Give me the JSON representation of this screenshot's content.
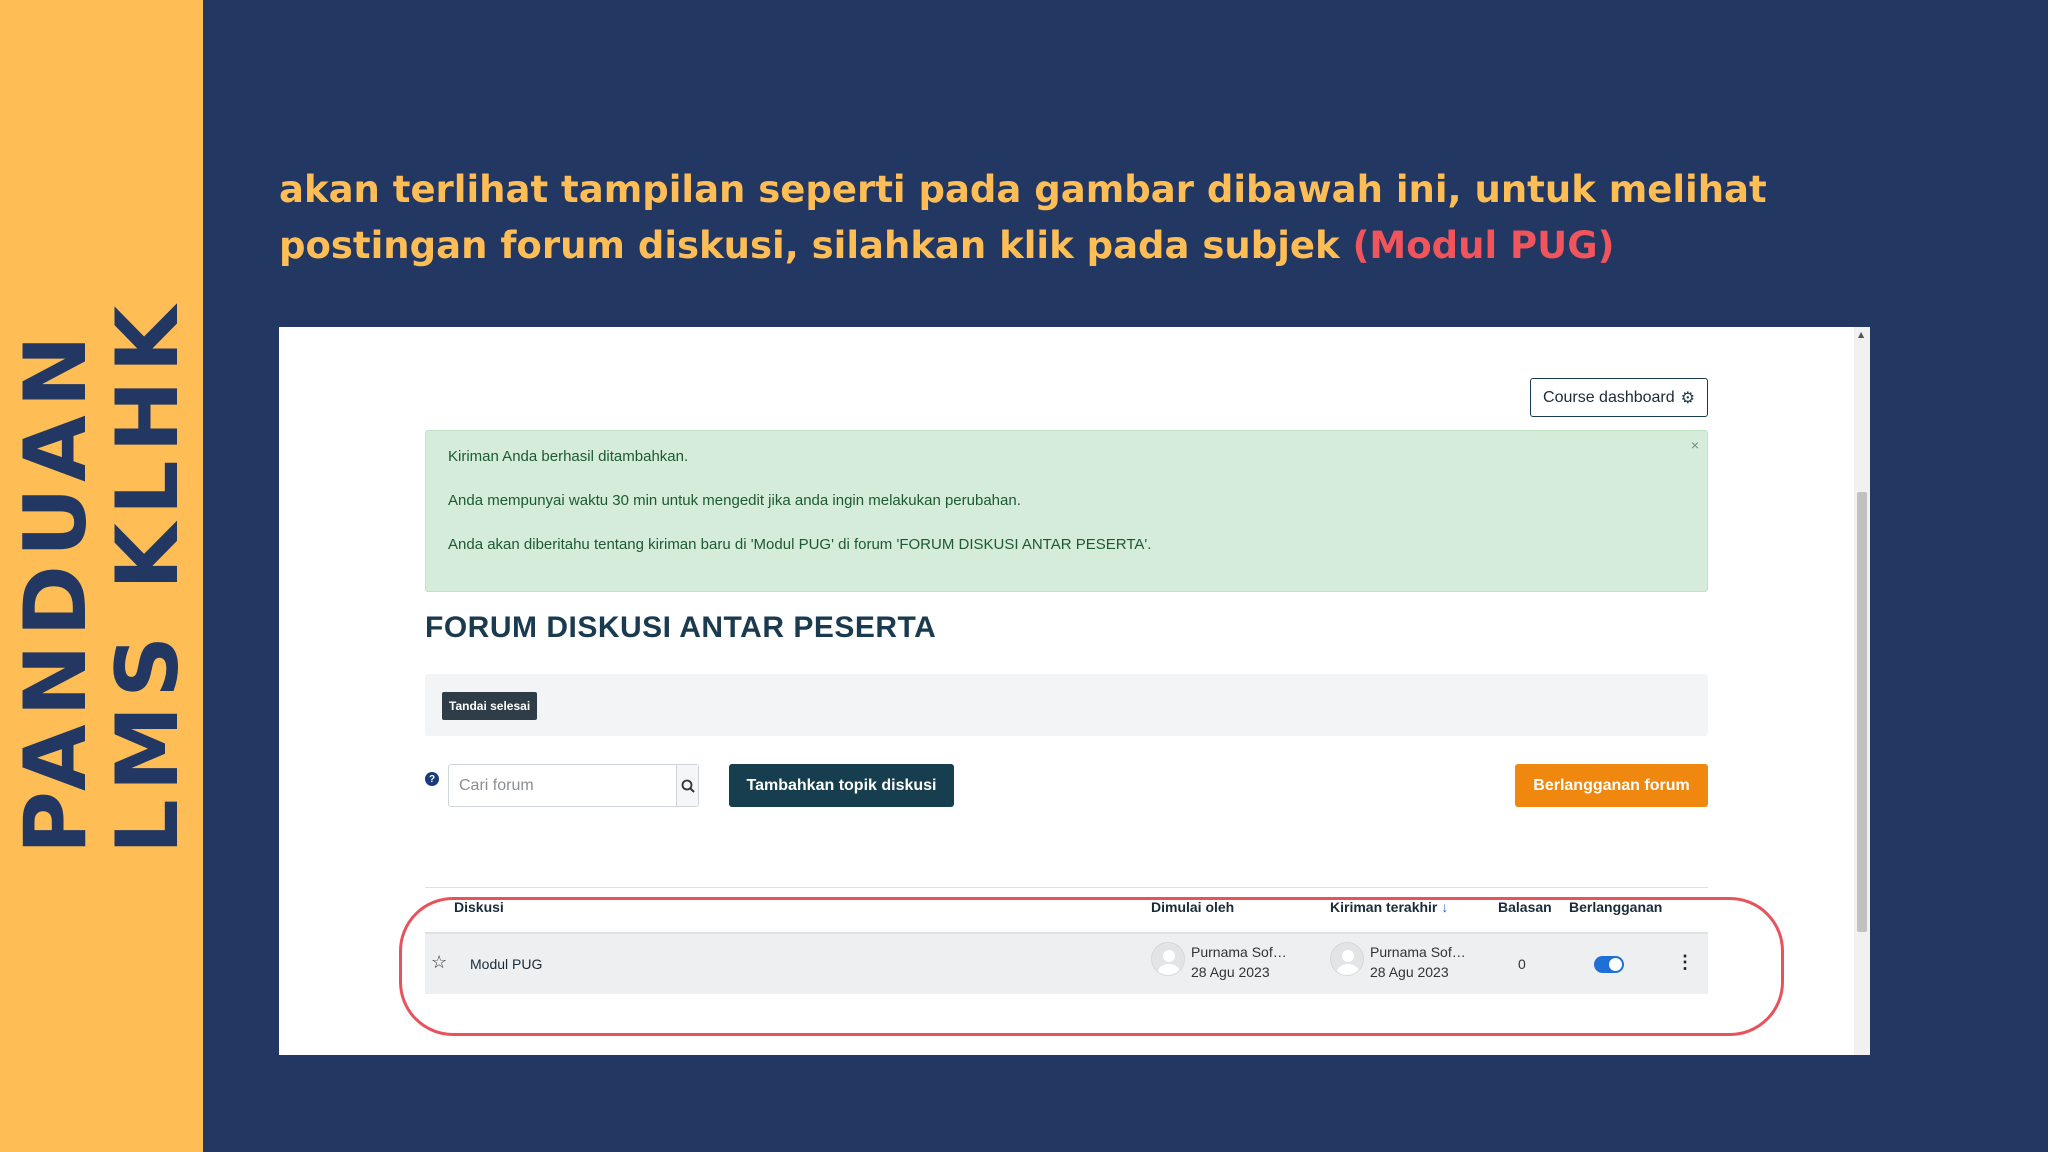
{
  "side_title": {
    "line1": "PANDUAN",
    "line2": "LMS KLHK"
  },
  "instruction": {
    "text": "akan terlihat tampilan seperti pada gambar dibawah ini, untuk melihat postingan forum diskusi, silahkan klik  pada subjek ",
    "highlight": "(Modul PUG)"
  },
  "colors": {
    "background": "#223761",
    "side_band": "#FEBE55",
    "instruction_text": "#FEBE55",
    "highlight": "#F2545B",
    "ring": "#E8525C"
  },
  "lms": {
    "course_dashboard_label": "Course dashboard",
    "alert": {
      "line1": "Kiriman Anda berhasil ditambahkan.",
      "line2": "Anda mempunyai waktu 30 min untuk mengedit jika anda ingin melakukan perubahan.",
      "line3": "Anda akan diberitahu tentang kiriman baru di 'Modul PUG' di forum 'FORUM DISKUSI ANTAR PESERTA'.",
      "close": "×"
    },
    "forum_title": "FORUM DISKUSI ANTAR PESERTA",
    "completion_badge": "Tandai selesai",
    "help_symbol": "?",
    "search_placeholder": "Cari forum",
    "add_topic_label": "Tambahkan topik diskusi",
    "subscribe_label": "Berlangganan forum",
    "table": {
      "headers": {
        "discussion": "Diskusi",
        "started_by": "Dimulai oleh",
        "last_post": "Kiriman terakhir",
        "sort_arrow": "↓",
        "replies": "Balasan",
        "subscription": "Berlangganan"
      },
      "rows": [
        {
          "subject": "Modul PUG",
          "started_by_name": "Purnama Sof…",
          "started_by_date": "28 Agu 2023",
          "last_post_name": "Purnama Sof…",
          "last_post_date": "28 Agu 2023",
          "replies": "0",
          "subscribed": true
        }
      ]
    },
    "icons": {
      "gear": "⚙",
      "search": "search-icon",
      "star": "☆",
      "kebab": "⋮"
    }
  }
}
